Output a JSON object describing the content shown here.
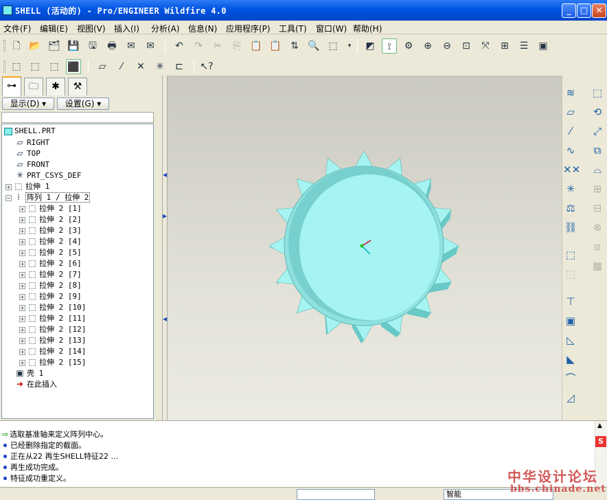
{
  "window": {
    "title": "SHELL (活动的) - Pro/ENGINEER Wildfire 4.0",
    "minimize": "_",
    "maximize": "□",
    "close": "✕"
  },
  "menu": [
    "文件(F)",
    "编辑(E)",
    "视图(V)",
    "插入(I)",
    "分析(A)",
    "信息(N)",
    "应用程序(P)",
    "工具(T)",
    "窗口(W)",
    "帮助(H)"
  ],
  "left_panel": {
    "show_dropdown": "显示(D) ▾",
    "settings_dropdown": "设置(G) ▾"
  },
  "tree": {
    "root": "SHELL.PRT",
    "datums": [
      "RIGHT",
      "TOP",
      "FRONT",
      "PRT_CSYS_DEF"
    ],
    "extrude1": "拉伸 1",
    "pattern": "阵列 1 / 拉伸 2",
    "pattern_members": [
      "拉伸 2 [1]",
      "拉伸 2 [2]",
      "拉伸 2 [3]",
      "拉伸 2 [4]",
      "拉伸 2 [5]",
      "拉伸 2 [6]",
      "拉伸 2 [7]",
      "拉伸 2 [8]",
      "拉伸 2 [9]",
      "拉伸 2 [10]",
      "拉伸 2 [11]",
      "拉伸 2 [12]",
      "拉伸 2 [13]",
      "拉伸 2 [14]",
      "拉伸 2 [15]"
    ],
    "shell": "壳 1",
    "insert_here": "在此插入"
  },
  "messages": {
    "prompt": "选取基准轴来定义阵列中心。",
    "history": [
      "已经删除指定的截面。",
      "正在从22 再生SHELL特征22 ...",
      "再生成功完成。",
      "特征成功重定义。"
    ]
  },
  "status": {
    "filter": "智能"
  },
  "watermark": {
    "name": "中华设计论坛",
    "url": "bbs.chinade.net"
  },
  "colors": {
    "model_face": "#a6f4f2",
    "model_shade": "#68c9c7",
    "titlebar": "#0054e3"
  }
}
